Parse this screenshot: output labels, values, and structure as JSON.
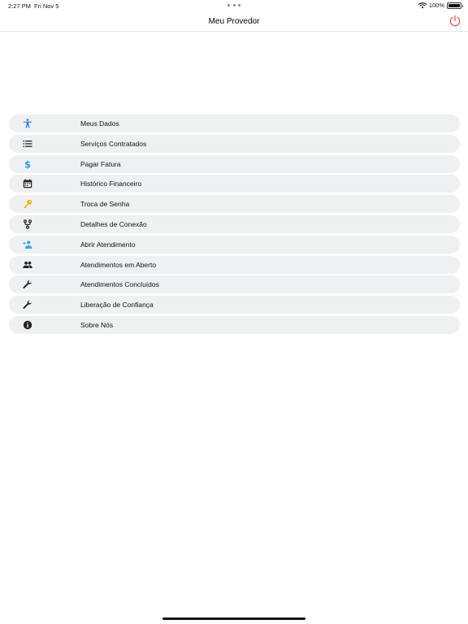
{
  "status_bar": {
    "time": "2:27 PM",
    "date": "Fri Nov 5",
    "battery": "100%",
    "battery_level": 1.0
  },
  "header": {
    "title": "Meu Provedor",
    "power_icon": "power-icon",
    "power_color": "#e8503f"
  },
  "menu": {
    "background": "#eef0f2",
    "items": [
      {
        "label": "Meus Dados",
        "icon": "accessibility-person-icon",
        "color": "#2d7df6"
      },
      {
        "label": "Serviços Contratados",
        "icon": "list-icon",
        "color": "#222222"
      },
      {
        "label": "Pagar Fatura",
        "icon": "dollar-icon",
        "color": "#2d9cf0"
      },
      {
        "label": "Histórico Financeiro",
        "icon": "calendar-icon",
        "color": "#222222"
      },
      {
        "label": "Troca de Senha",
        "icon": "key-icon",
        "color": "#f2b705"
      },
      {
        "label": "Detalhes de Conexão",
        "icon": "fork-icon",
        "color": "#222222"
      },
      {
        "label": "Abrir Atendimento",
        "icon": "add-person-icon",
        "color": "#3aa8e8"
      },
      {
        "label": "Atendimentos em Aberto",
        "icon": "group-icon",
        "color": "#222222"
      },
      {
        "label": "Atendimentos Concluídos",
        "icon": "wrench-icon",
        "color": "#222222"
      },
      {
        "label": "Liberação de Confiança",
        "icon": "wrench-icon",
        "color": "#222222"
      },
      {
        "label": "Sobre Nós",
        "icon": "info-icon",
        "color": "#222222"
      }
    ]
  }
}
